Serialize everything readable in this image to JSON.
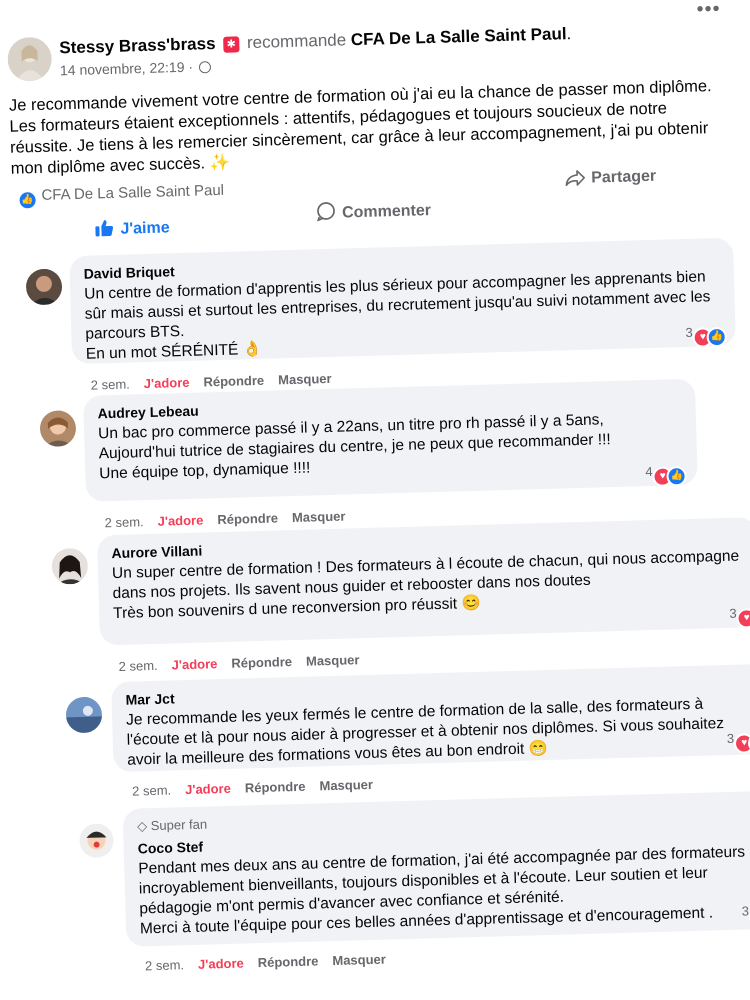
{
  "post": {
    "author": "Stessy Brass'brass",
    "badge_icon": "recommend-badge-icon",
    "recommends_word": "recommande",
    "page_name": "CFA De La Salle Saint Paul",
    "page_name_period": ".",
    "date": "14 novembre, 22:19 ·",
    "globe_icon": "globe-icon",
    "more_icon": "•••",
    "text": "Je recommande vivement votre centre de formation où j'ai eu la chance de passer mon diplôme. Les formateurs étaient exceptionnels : attentifs, pédagogues et toujours soucieux de notre réussite. Je tiens à les remercier sincèrement, car grâce à leur accompagnement, j'ai pu obtenir mon diplôme avec succès. ✨",
    "page_tag": "CFA De La Salle Saint Paul"
  },
  "actions_bar": {
    "like_label": "J'aime",
    "comment_label": "Commenter",
    "share_label": "Partager"
  },
  "comments": [
    {
      "name": "David Briquet",
      "text": "Un centre de formation d'apprentis les plus sérieux pour accompagner les apprenants bien sûr mais aussi et surtout les entreprises, du recrutement jusqu'au suivi notamment avec les parcours BTS.\nEn un mot SÉRÉNITÉ 👌",
      "reaction_count": "3",
      "time": "2 sem.",
      "adore": "J'adore",
      "reply": "Répondre",
      "hide": "Masquer"
    },
    {
      "name": "Audrey Lebeau",
      "text": "Un bac pro commerce passé il y a 22ans, un titre pro rh passé il y a 5ans, Aujourd'hui tutrice de stagiaires du centre, je ne peux que recommander !!!\nUne équipe top, dynamique !!!!",
      "reaction_count": "4",
      "time": "2 sem.",
      "adore": "J'adore",
      "reply": "Répondre",
      "hide": "Masquer"
    },
    {
      "name": "Aurore Villani",
      "text": "Un super centre de formation ! Des formateurs à l écoute de chacun, qui nous accompagne dans nos projets. Ils savent nous guider et rebooster dans nos doutes\nTrès bon souvenirs d une reconversion pro réussit 😊",
      "reaction_count": "3",
      "time": "2 sem.",
      "adore": "J'adore",
      "reply": "Répondre",
      "hide": "Masquer"
    },
    {
      "name": "Mar Jct",
      "text": "Je recommande les yeux fermés le centre de formation de la salle, des formateurs à l'écoute et là pour nous aider à progresser et à obtenir nos diplômes. Si vous souhaitez avoir la meilleure des formations vous êtes au bon endroit 😁",
      "reaction_count": "3",
      "time": "2 sem.",
      "adore": "J'adore",
      "reply": "Répondre",
      "hide": "Masquer"
    },
    {
      "badge": "Super fan",
      "name": "Coco Stef",
      "text": "Pendant mes deux ans au centre de formation, j'ai été accompagnée par des formateurs incroyablement bienveillants, toujours disponibles et à l'écoute. Leur soutien et leur pédagogie m'ont permis d'avancer avec confiance et sérénité.\nMerci à toute l'équipe pour ces belles années d'apprentissage et d'encouragement .",
      "reaction_count": "3",
      "time": "2 sem.",
      "adore": "J'adore",
      "reply": "Répondre",
      "hide": "Masquer"
    }
  ],
  "colors": {
    "like_blue": "#1877f2",
    "love_red": "#f33e58",
    "bubble_gray": "#f0f2f5",
    "secondary_text": "#65676b"
  }
}
